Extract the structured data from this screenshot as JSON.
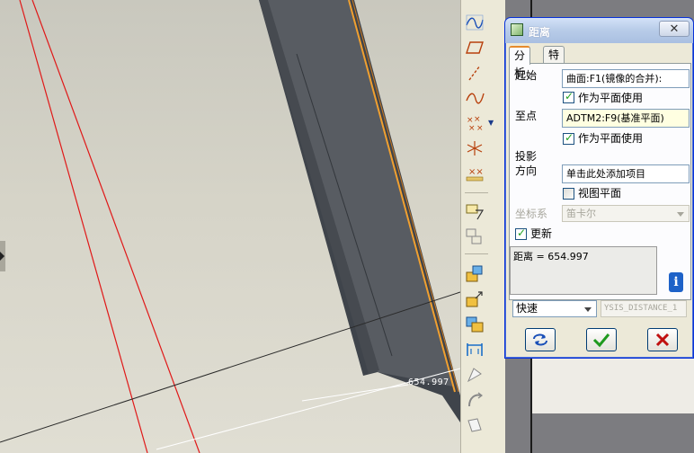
{
  "viewport": {
    "distance_label": "654.997"
  },
  "toolbar": {
    "icons": [
      "sketch-curve-icon",
      "datum-plane-icon",
      "datum-axis-icon",
      "datum-curve-icon",
      "datum-point-icon",
      "datum-csys-icon",
      "datum-point-offset-icon",
      "analysis-feature-icon",
      "copy-geometry-icon",
      "merge-icon",
      "extend-icon",
      "trim-icon",
      "intersect-icon",
      "thicken-icon",
      "project-icon",
      "solidify-icon",
      "offset-icon"
    ]
  },
  "dialog": {
    "title": "距离",
    "close_label": "✕",
    "tabs": [
      {
        "label": "分析",
        "active": true
      },
      {
        "label": "特征",
        "active": false
      }
    ],
    "from": {
      "label": "起始",
      "value": "曲面:F1(镜像的合并):",
      "use_as_plane_label": "作为平面使用",
      "use_as_plane_checked": true
    },
    "to": {
      "label": "至点",
      "value": "ADTM2:F9(基准平面)",
      "use_as_plane_label": "作为平面使用",
      "use_as_plane_checked": true
    },
    "projection": {
      "label_line1": "投影",
      "label_line2": "方向",
      "value": "单击此处添加项目",
      "view_plane_label": "视图平面",
      "view_plane_checked": false
    },
    "csys": {
      "label": "坐标系",
      "value": "笛卡尔"
    },
    "update": {
      "label": "更新",
      "checked": true
    },
    "result_text": "距离 = 654.997",
    "mode_value": "快速",
    "analysis_name": "YSIS_DISTANCE_1",
    "buttons": {
      "repeat": "repeat-icon",
      "ok": "checkmark-icon",
      "cancel": "cancel-x-icon"
    }
  }
}
